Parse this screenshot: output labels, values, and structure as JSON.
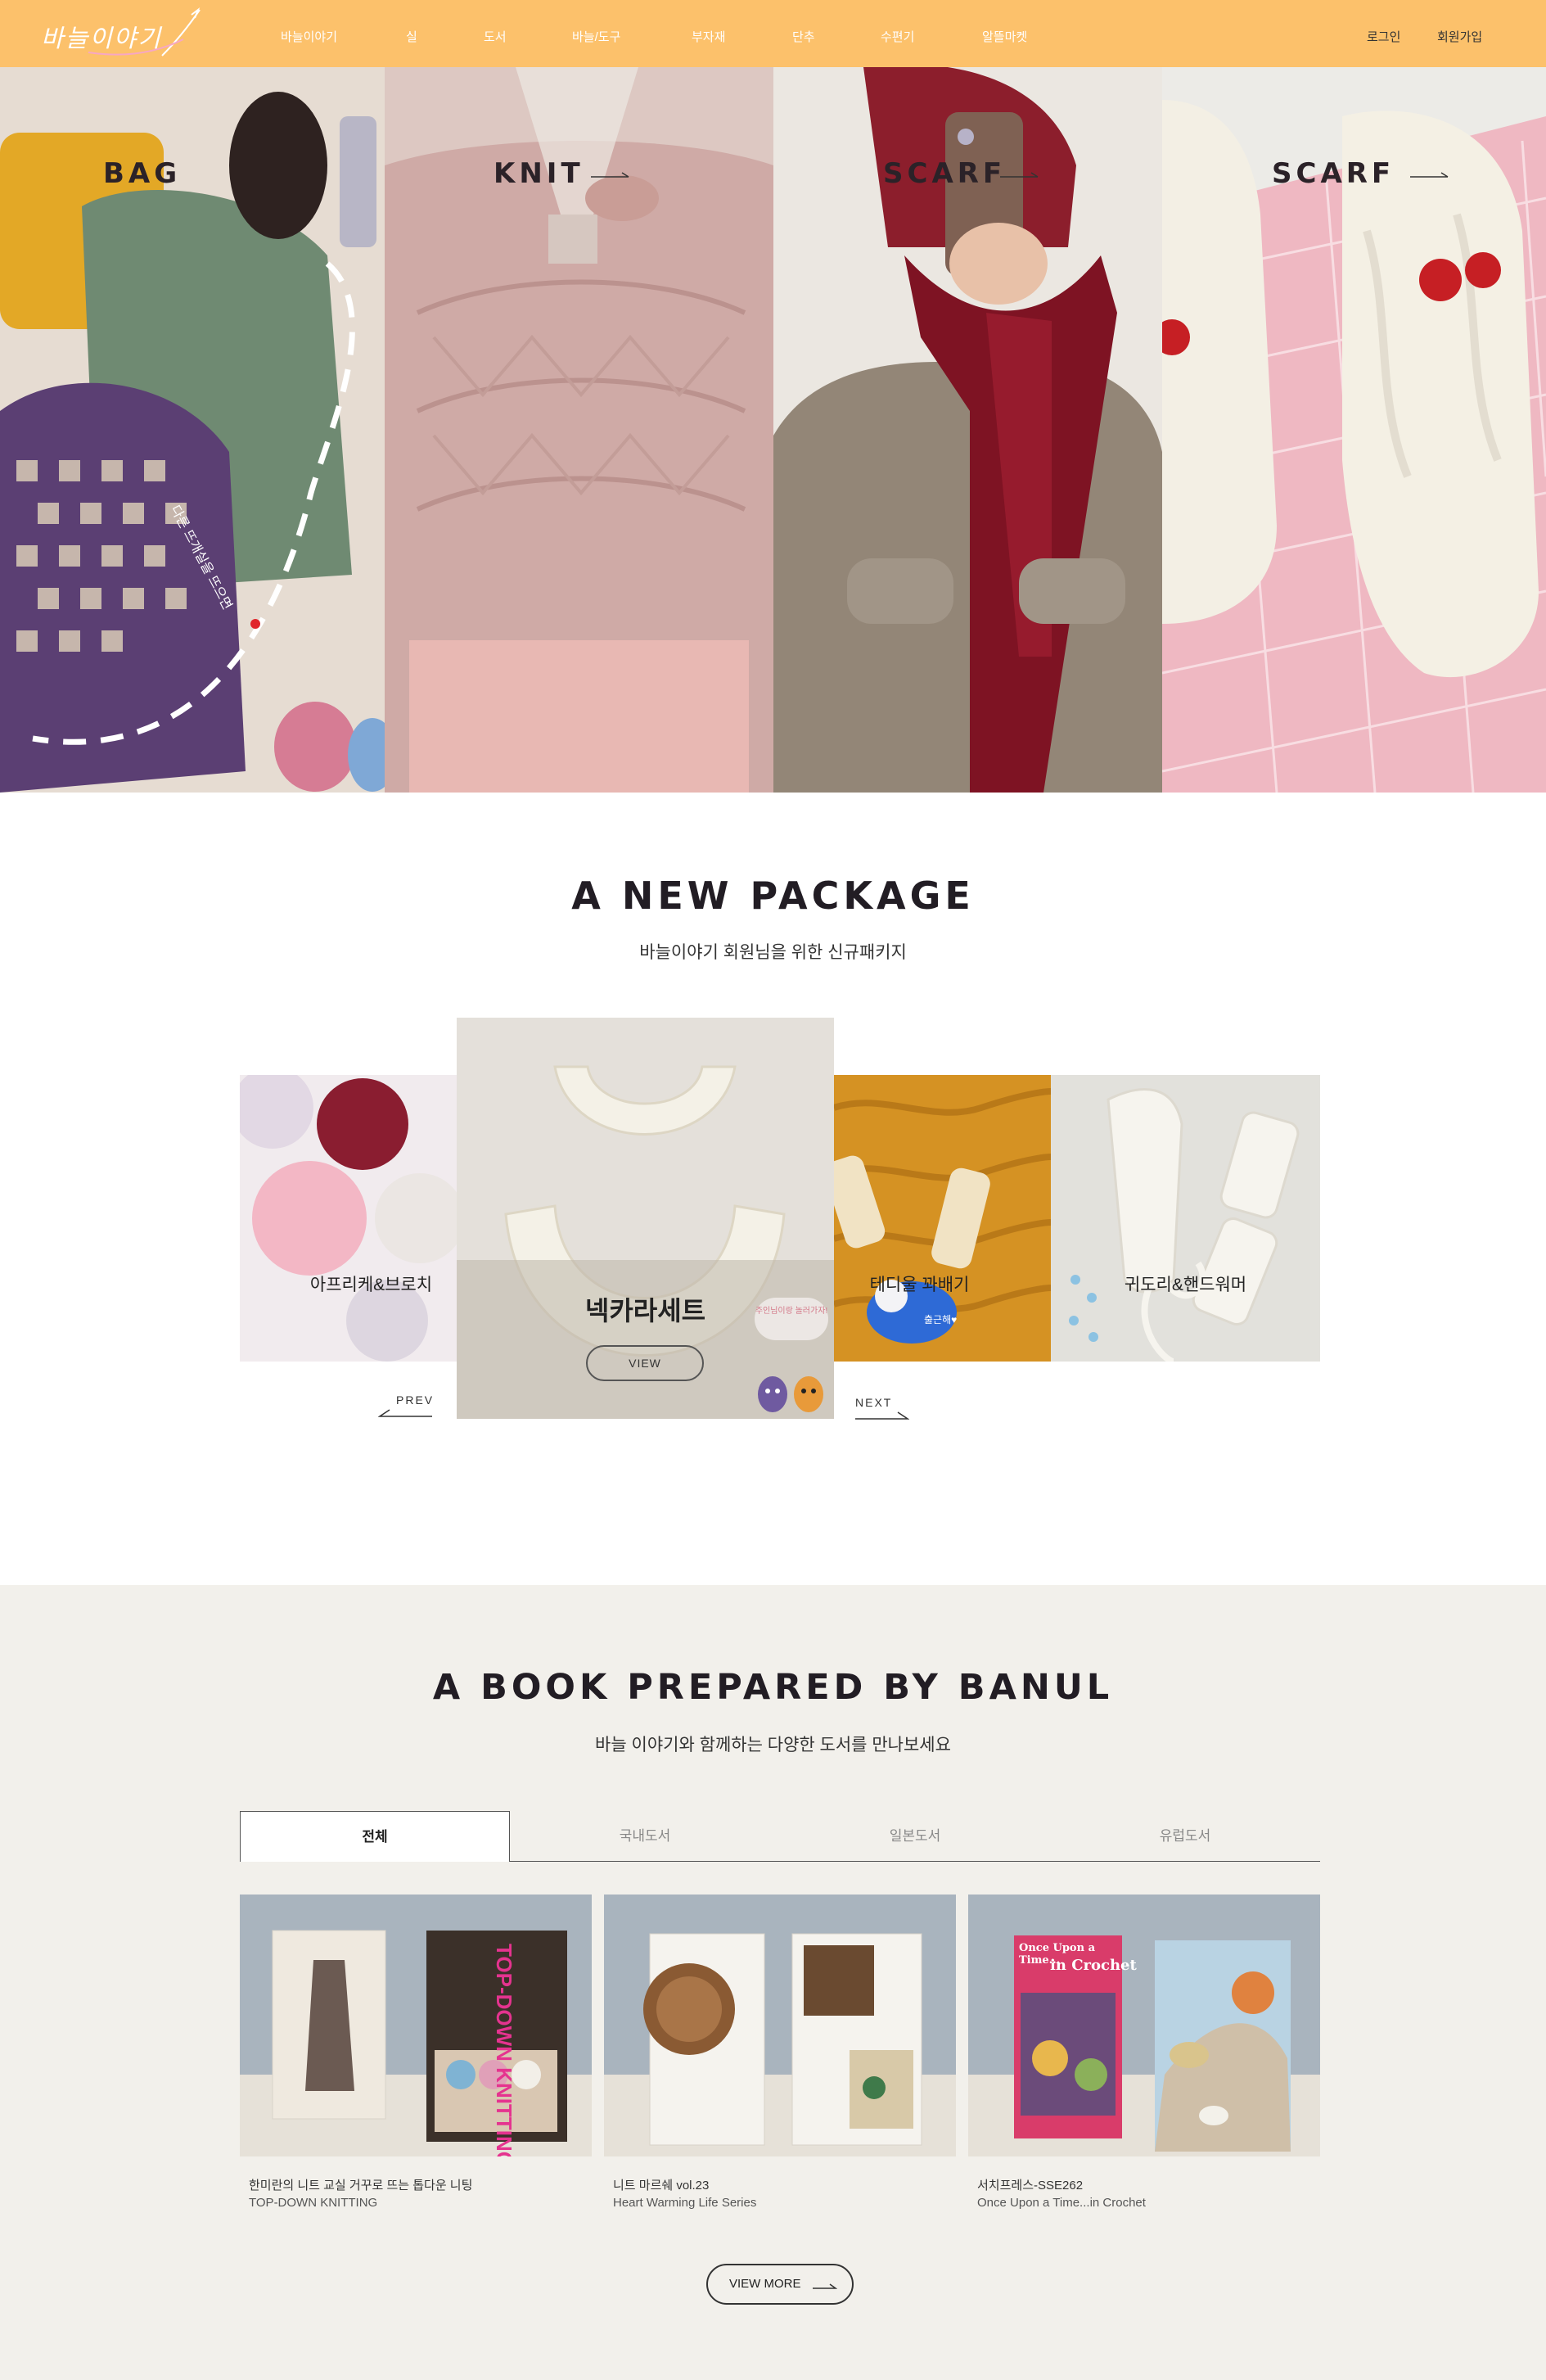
{
  "header": {
    "logo_text": "바늘이야기",
    "nav": [
      "바늘이야기",
      "실",
      "도서",
      "바늘/도구",
      "부자재",
      "단추",
      "수편기",
      "알뜰마켓"
    ],
    "login": "로그인",
    "signup": "회원가입",
    "bg_color": "#fcc16b"
  },
  "hero": {
    "panels": [
      {
        "label": "BAG",
        "icon": "arrow-right-icon",
        "overlay_text": "다른 뜨개실을 뜨으면"
      },
      {
        "label": "KNIT",
        "icon": "arrow-right-icon"
      },
      {
        "label": "SCARF",
        "icon": "arrow-right-icon"
      },
      {
        "label": "SCARF",
        "icon": "arrow-right-icon"
      }
    ]
  },
  "package": {
    "title": "A NEW PACKAGE",
    "subtitle": "바늘이야기 회원님을 위한 신규패키지",
    "cards": [
      {
        "label": "아프리케&브로치"
      },
      {
        "label": "넥카라세트",
        "button": "VIEW",
        "sticker": "주인님이랑 놀러가자!"
      },
      {
        "label": "테디울 꽈배기",
        "sticker": "출근해♥"
      },
      {
        "label": "귀도리&핸드워머"
      }
    ],
    "prev": "PREV",
    "next": "NEXT"
  },
  "books": {
    "title": "A BOOK PREPARED BY BANUL",
    "subtitle": "바늘 이야기와 함께하는 다양한 도서를 만나보세요",
    "tabs": [
      "전체",
      "국내도서",
      "일본도서",
      "유럽도서"
    ],
    "active_tab": 0,
    "items": [
      {
        "line1": "한미란의 니트 교실 거꾸로 뜨는 톱다운 니팅",
        "line2": "TOP-DOWN KNITTING",
        "cover_text_a": "TOP-DOWN KNITTING"
      },
      {
        "line1": "니트 마르쉐 vol.23",
        "line2": "Heart Warming Life Series"
      },
      {
        "line1": "서치프레스-SSE262",
        "line2": "Once Upon a Time...in Crochet",
        "cover_text_a": "Once Upon a Time...",
        "cover_text_b": "in Crochet"
      }
    ],
    "more": "VIEW MORE"
  }
}
